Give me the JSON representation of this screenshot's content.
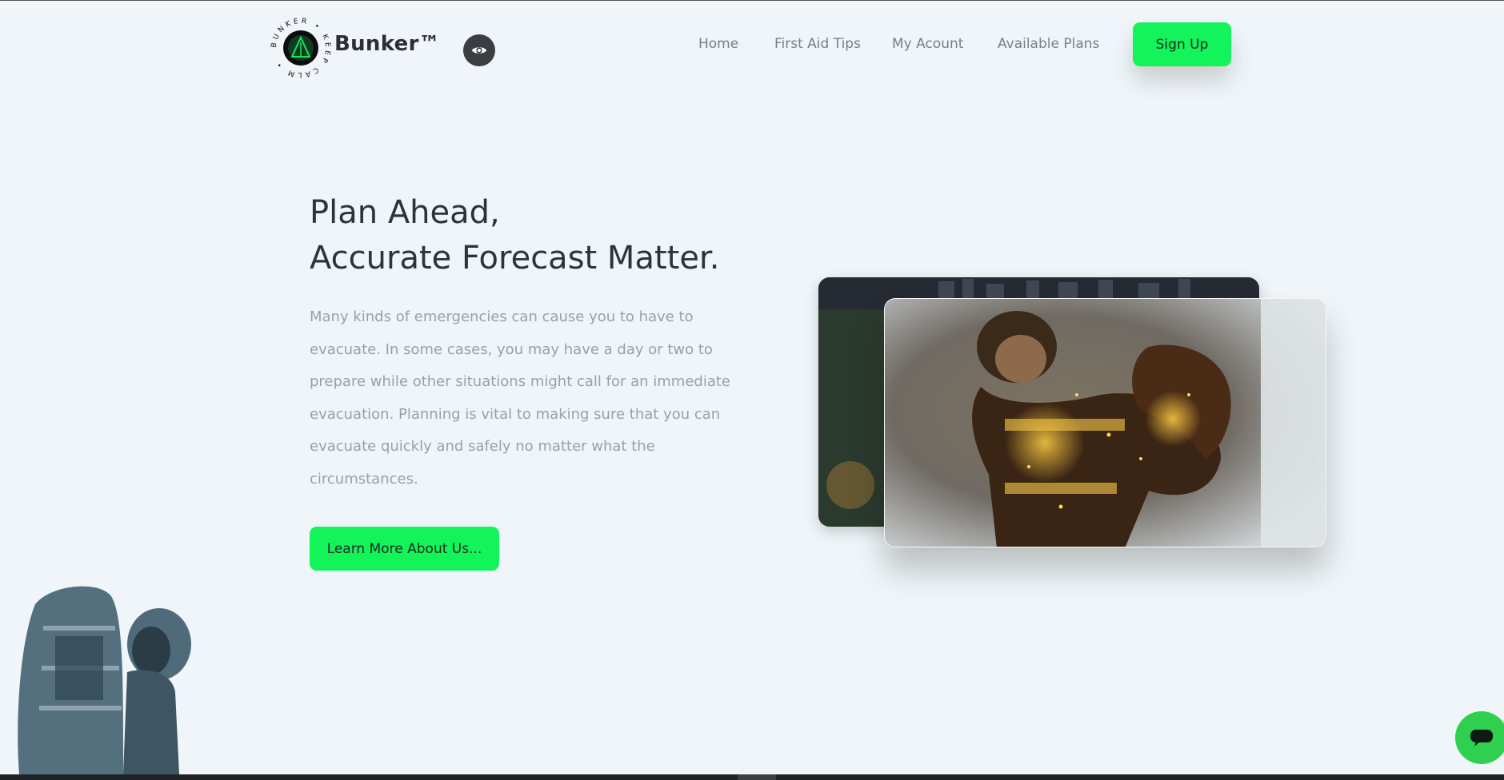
{
  "header": {
    "brand": "Bunker™",
    "logo_ring_text": "BUNKER • KEEP CALM •",
    "nav": [
      "Home",
      "First Aid Tips",
      "My Acount",
      "Available Plans"
    ],
    "signup_label": "Sign Up"
  },
  "hero": {
    "title_line1": "Plan Ahead,",
    "title_line2": "Accurate Forecast Matter.",
    "description": "Many kinds of emergencies can cause you to have to evacuate. In some cases, you may have a day or two to prepare while other situations might call for an immediate evacuation. Planning is vital to making sure that you can evacuate quickly and safely no matter what the circumstances.",
    "cta_label": "Learn More About Us..."
  },
  "colors": {
    "accent": "#13f35a",
    "background": "#eff5f8",
    "text_dark": "#2e3336",
    "text_muted": "#9aa0a5",
    "chat": "#2fcf4f"
  },
  "icons": [
    "bunker-logo-icon",
    "eye-icon",
    "chat-icon"
  ]
}
